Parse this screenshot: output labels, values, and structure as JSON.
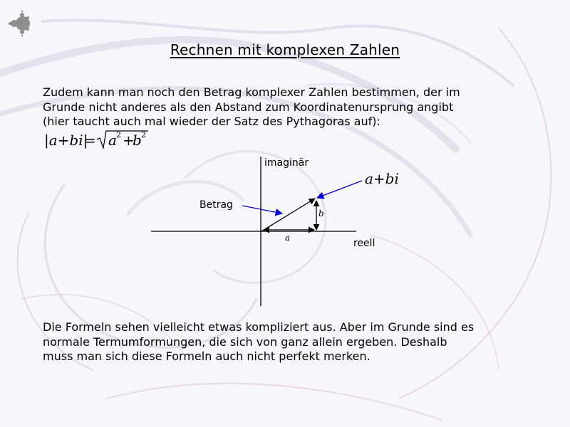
{
  "slide": {
    "title": "Rechnen mit komplexen Zahlen",
    "paragraph1_lines": [
      "Zudem kann man noch den Betrag komplexer Zahlen bestimmen, der im",
      "Grunde nicht anderes als den Abstand zum Koordinatenursprung angibt",
      "(hier taucht auch mal wieder der Satz des Pythagoras auf):"
    ],
    "paragraph2_lines": [
      "Die Formeln sehen vielleicht etwas kompliziert aus. Aber im Grunde sind es",
      "normale Termumformungen, die sich von ganz allein ergeben. Deshalb",
      "muss man sich diese Formeln auch nicht perfekt merken."
    ]
  },
  "formula": {
    "lhs": "|a+bi|",
    "equals": "=",
    "radicand_a": "a",
    "radicand_b": "b",
    "exponent": "2",
    "plus": "+"
  },
  "diagram": {
    "axis_imag_label": "imaginär",
    "axis_real_label": "reell",
    "betrag_label": "Betrag",
    "point_label": "a+bi",
    "side_a_label": "a",
    "side_b_label": "b"
  },
  "colors": {
    "pointer_arrow": "#0000cc",
    "axes": "#000000",
    "background": "#f7f6fa"
  }
}
